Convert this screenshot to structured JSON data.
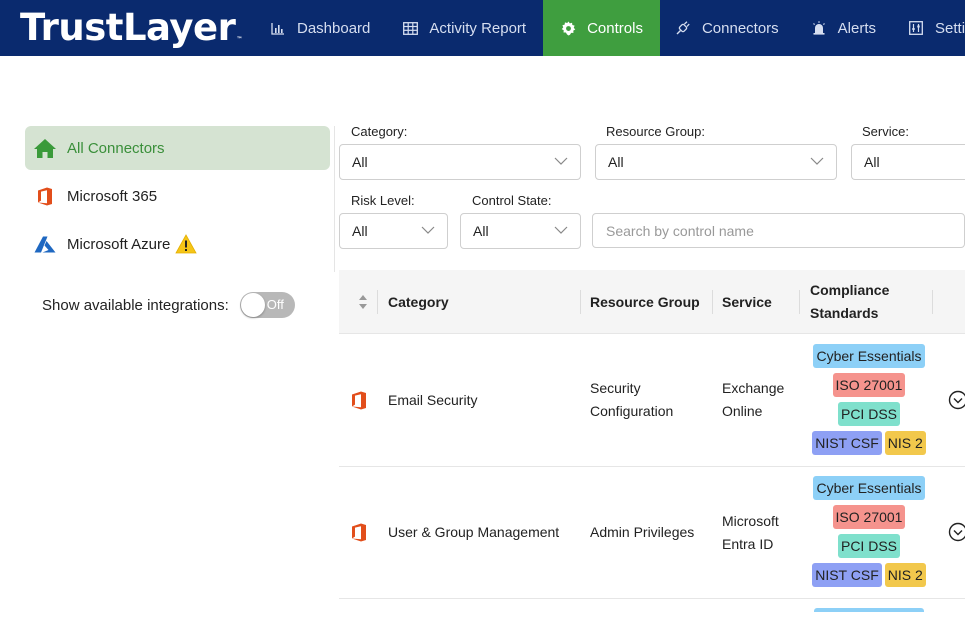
{
  "app": {
    "brand": "TrustLayer",
    "brand_mark": "™"
  },
  "nav": [
    {
      "label": "Dashboard",
      "icon": "bar-chart-icon"
    },
    {
      "label": "Activity Report",
      "icon": "table-icon"
    },
    {
      "label": "Controls",
      "icon": "gear-icon",
      "active": true
    },
    {
      "label": "Connectors",
      "icon": "plug-icon"
    },
    {
      "label": "Alerts",
      "icon": "siren-icon"
    },
    {
      "label": "Settings",
      "icon": "sliders-icon"
    }
  ],
  "sidebar": {
    "items": [
      {
        "label": "All Connectors",
        "icon": "home-icon",
        "active": true
      },
      {
        "label": "Microsoft 365",
        "icon": "office-icon"
      },
      {
        "label": "Microsoft Azure",
        "icon": "azure-icon",
        "warning": true
      }
    ],
    "integrations_label": "Show available integrations:",
    "toggle_label": "Off"
  },
  "filters": {
    "category": {
      "label": "Category:",
      "value": "All"
    },
    "resource_group": {
      "label": "Resource Group:",
      "value": "All"
    },
    "service": {
      "label": "Service:",
      "value": "All"
    },
    "risk_level": {
      "label": "Risk Level:",
      "value": "All"
    },
    "control_state": {
      "label": "Control State:",
      "value": "All"
    },
    "search_placeholder": "Search by control name"
  },
  "table": {
    "headers": {
      "category": "Category",
      "resource_group": "Resource Group",
      "service": "Service",
      "compliance_line1": "Compliance",
      "compliance_line2": "Standards"
    },
    "rows": [
      {
        "category": "Email Security",
        "resource_group_line1": "Security",
        "resource_group_line2": "Configuration",
        "service_line1": "Exchange",
        "service_line2": "Online",
        "standards": [
          "Cyber Essentials",
          "ISO 27001",
          "PCI DSS",
          "NIST CSF",
          "NIS 2"
        ]
      },
      {
        "category": "User & Group Management",
        "resource_group_line1": "Admin Privileges",
        "resource_group_line2": "",
        "service_line1": "Microsoft",
        "service_line2": "Entra ID",
        "standards": [
          "Cyber Essentials",
          "ISO 27001",
          "PCI DSS",
          "NIST CSF",
          "NIS 2"
        ]
      }
    ]
  },
  "colors": {
    "nav_bg": "#0a2a6e",
    "nav_active": "#3f9e3f",
    "sidebar_active_bg": "#d5e3d2",
    "office_orange": "#e24e1b",
    "azure_blue": "#1f68c1",
    "warning_yellow": "#f5c518"
  }
}
